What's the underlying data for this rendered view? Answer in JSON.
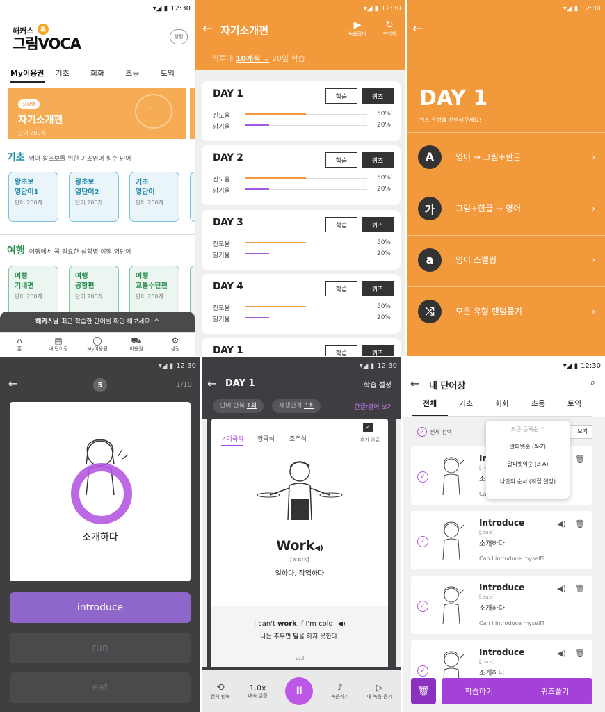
{
  "status": {
    "time": "12:30"
  },
  "p1": {
    "brand_small": "해커스",
    "brand_badge": "톡",
    "brand_big": "그림VOCA",
    "ranking": "랭킹",
    "tabs": [
      "My이용권",
      "기초",
      "회화",
      "초등",
      "토익"
    ],
    "banner": {
      "pill": "상황별",
      "title": "자기소개편",
      "count": "단어 200개",
      "bubble": "···"
    },
    "basic": {
      "title": "기초",
      "sub": "영어 왕초보를 위한 기초영어 필수 단어",
      "cards": [
        {
          "l1": "왕초보",
          "l2": "영단어1",
          "c": "단어 200개"
        },
        {
          "l1": "왕초보",
          "l2": "영단어2",
          "c": "단어 200개"
        },
        {
          "l1": "기초",
          "l2": "영단어",
          "c": "단어 200개"
        }
      ]
    },
    "travel": {
      "title": "여행",
      "sub": "여행에서 꼭 필요한 상황별 여행 영단어",
      "cards": [
        {
          "l1": "여행",
          "l2": "기내편",
          "c": "단어 200개"
        },
        {
          "l1": "여행",
          "l2": "공항편",
          "c": "단어 200개"
        },
        {
          "l1": "여행",
          "l2": "교통수단편",
          "c": "단어 200개"
        }
      ]
    },
    "toast": {
      "name": "해커스님",
      "msg": "최근 학습한 단어를 확인 해보세요. ^"
    },
    "nav": [
      {
        "icon": "⌂",
        "label": "홈"
      },
      {
        "icon": "▤",
        "label": "내 단어장"
      },
      {
        "icon": "◯",
        "label": "My이용권"
      },
      {
        "icon": "⛟",
        "label": "이용권"
      },
      {
        "icon": "⚙",
        "label": "설정"
      }
    ]
  },
  "p2": {
    "title": "자기소개편",
    "act1": "녹음관리",
    "act2": "초기화",
    "daily_pre": "하루에",
    "daily_val": "10개씩 ⌄",
    "daily_post": "20일 학습",
    "labels": {
      "progress": "진도율",
      "memory": "암기율",
      "study": "학습",
      "quiz": "퀴즈"
    },
    "days": [
      {
        "name": "DAY 1",
        "p": "50%",
        "m": "20%",
        "pv": 0.5,
        "mv": 0.2
      },
      {
        "name": "DAY 2",
        "p": "50%",
        "m": "20%",
        "pv": 0.5,
        "mv": 0.2
      },
      {
        "name": "DAY 3",
        "p": "50%",
        "m": "20%",
        "pv": 0.5,
        "mv": 0.2
      },
      {
        "name": "DAY 4",
        "p": "50%",
        "m": "20%",
        "pv": 0.5,
        "mv": 0.2
      },
      {
        "name": "DAY 1"
      }
    ]
  },
  "p3": {
    "day": "DAY 1",
    "sub": "퀴즈 유형을 선택해주세요!",
    "options": [
      {
        "icon": "A",
        "label": "영어 → 그림+한글"
      },
      {
        "icon": "가",
        "label": "그림+한글 → 영어"
      },
      {
        "icon": "a",
        "label": "영어 스펠링"
      },
      {
        "icon": "⤮",
        "label": "모든 유형 랜덤풀기"
      }
    ]
  },
  "p4": {
    "timer": "5",
    "count": "1/10",
    "word": "소개하다",
    "answers": [
      "introduce",
      "run",
      "eat"
    ]
  },
  "p5": {
    "title": "DAY 1",
    "setting": "학습 설정",
    "repeat_label": "단어 반복",
    "repeat_val": "1회",
    "interval_label": "재생간격",
    "interval_val": "3초",
    "toggle": "한글/영어 보기",
    "accents": [
      "✓미국식",
      "영국식",
      "호주식"
    ],
    "added": "추가 완료",
    "word": "Work",
    "phon": "[wɜːrk]",
    "meaning": "일하다, 작업하다",
    "ex_en_pre": "I can't ",
    "ex_en_bold": "work",
    "ex_en_post": " if I'm cold.",
    "ex_ko_pre": "나는 추우면 ",
    "ex_ko_bold": "일",
    "ex_ko_post": "을 하지 못한다.",
    "page": "2/3",
    "foot": [
      {
        "i": "⟲",
        "l": "전체 반복"
      },
      {
        "i": "1.0x",
        "l": "배속 설정"
      },
      {
        "i": "Ⅱ",
        "l": ""
      },
      {
        "i": "♪",
        "l": "녹음하기"
      },
      {
        "i": "▷",
        "l": "내 녹음 듣기"
      }
    ]
  },
  "p6": {
    "title": "내 단어장",
    "tabs": [
      "전체",
      "기초",
      "회화",
      "초등",
      "토익"
    ],
    "select_all": "전체 선택",
    "view": "보기",
    "dropdown": [
      "최근 등록순 ^",
      "알파벳순 (A-Z)",
      "알파벳역순 (Z-A)",
      "나만의 순서 (직접 설정)"
    ],
    "items": [
      {
        "w": "Introduce",
        "p": "[ˌdu:s]",
        "m": "소개하다",
        "e": "Can I introduce myself?"
      },
      {
        "w": "Introduce",
        "p": "[ˌdu:s]",
        "m": "소개하다",
        "e": "Can I introduce myself?"
      },
      {
        "w": "Introduce",
        "p": "[ˌdu:s]",
        "m": "소개하다",
        "e": "Can I introduce myself?"
      },
      {
        "w": "Introduce",
        "p": "[ˌdu:s]",
        "m": "소개하다",
        "e": ""
      }
    ],
    "study": "학습하기",
    "quiz": "퀴즈풀기"
  },
  "colors": {
    "orange": "#f29a3b",
    "purple": "#a540d8",
    "teal": "#188d9c",
    "green": "#2d8f56"
  }
}
